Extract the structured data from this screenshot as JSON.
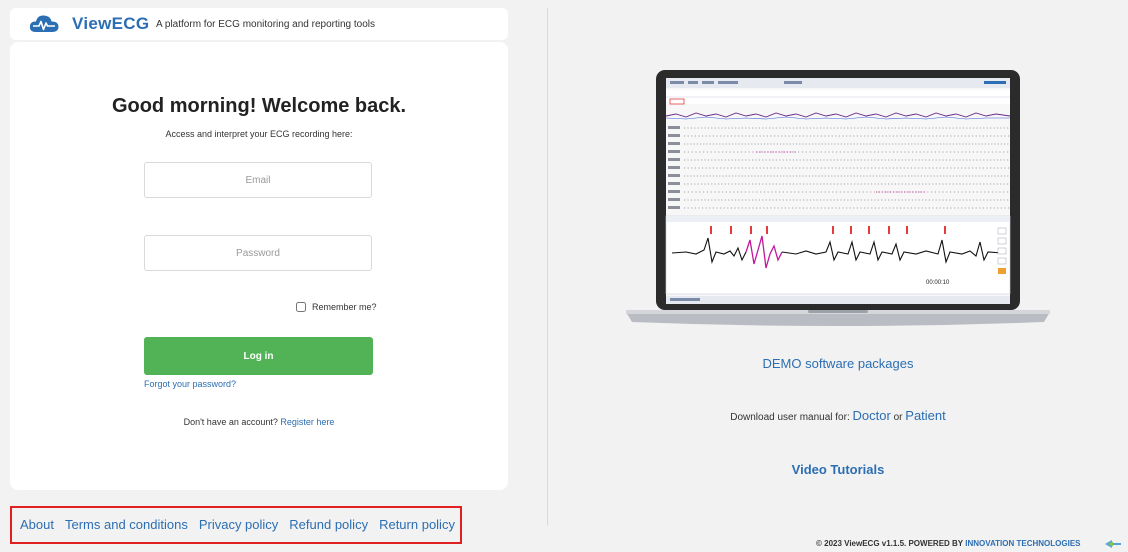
{
  "header": {
    "logo_text": "ViewECG",
    "tagline": "A platform for ECG monitoring and reporting tools"
  },
  "login": {
    "greeting": "Good morning! Welcome back.",
    "subtitle": "Access and interpret your ECG recording here:",
    "email_placeholder": "Email",
    "password_placeholder": "Password",
    "remember_label": "Remember me?",
    "login_button": "Log in",
    "forgot_password": "Forgot your password?",
    "no_account_text": "Don't have an account?",
    "register_link": "Register here"
  },
  "footer_links": [
    "About",
    "Terms and conditions",
    "Privacy policy",
    "Refund policy",
    "Return policy"
  ],
  "right": {
    "demo_link": "DEMO software packages",
    "manual_prefix": "Download user manual for:",
    "manual_doctor": "Doctor",
    "manual_or": "or",
    "manual_patient": "Patient",
    "video_tutorials": "Video Tutorials",
    "screen_time_readout": "00:00:10"
  },
  "copyright": {
    "text": "© 2023 ViewECG v1.1.5. POWERED BY",
    "brand": "INNOVATION TECHNOLOGIES"
  },
  "colors": {
    "brand_blue": "#2c6eb3",
    "login_green": "#52b356",
    "highlight_red": "#e02020",
    "page_bg": "#f2f2f2"
  },
  "icons": {
    "logo": "cloud-heartbeat-icon",
    "checkbox": "checkbox-icon",
    "powered_by": "innovation-technologies-logo-icon"
  }
}
